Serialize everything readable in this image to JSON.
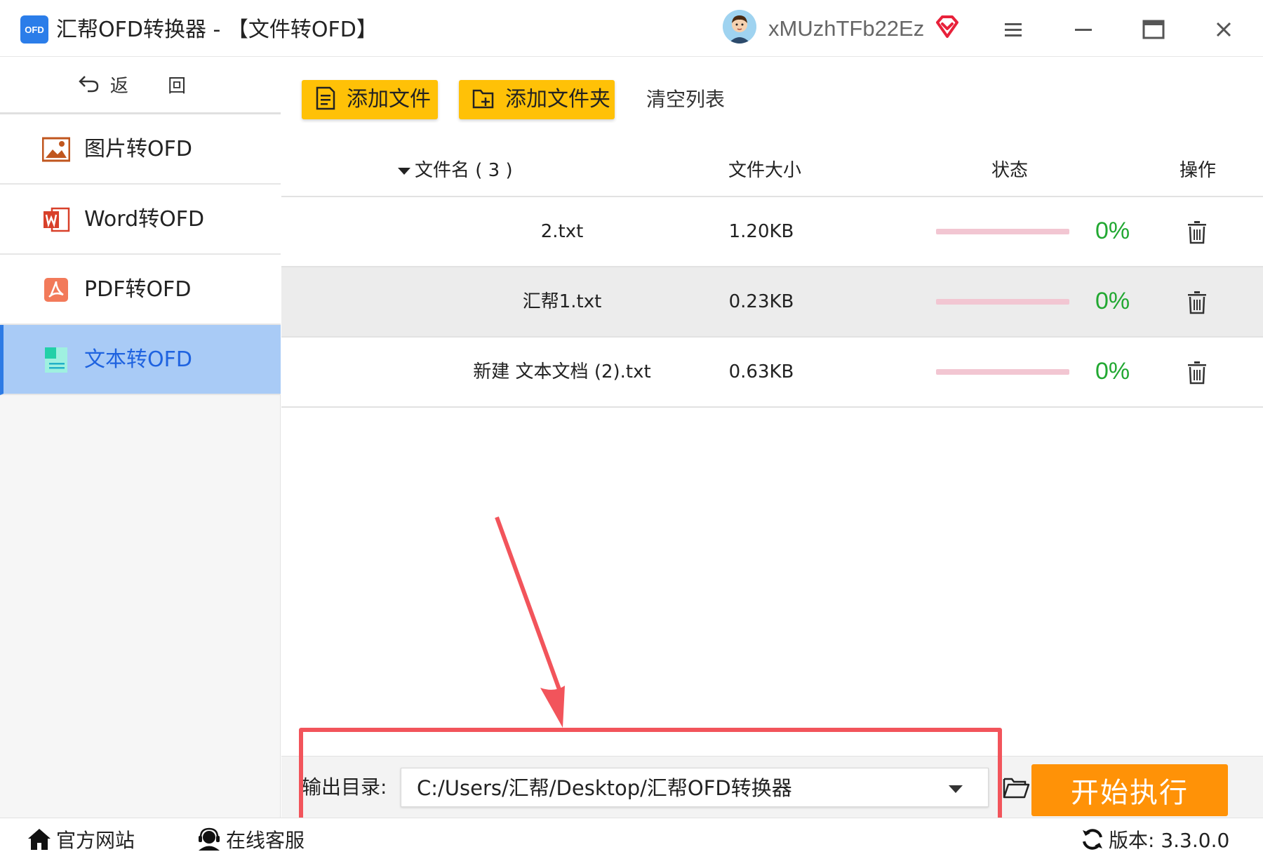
{
  "titlebar": {
    "logo_text": "OFD",
    "title": "汇帮OFD转换器 - 【文件转OFD】",
    "username": "xMUzhTFb22Ez"
  },
  "sidebar": {
    "back_label": "返 回",
    "items": [
      {
        "label": "图片转OFD"
      },
      {
        "label": "Word转OFD"
      },
      {
        "label": "PDF转OFD"
      },
      {
        "label": "文本转OFD"
      }
    ]
  },
  "toolbar": {
    "add_file": "添加文件",
    "add_folder": "添加文件夹",
    "clear_list": "清空列表"
  },
  "table": {
    "headers": {
      "name": "文件名 ( 3 )",
      "size": "文件大小",
      "status": "状态",
      "action": "操作"
    },
    "rows": [
      {
        "name": "2.txt",
        "size": "1.20KB",
        "progress": 0,
        "percent": "0%"
      },
      {
        "name": "汇帮1.txt",
        "size": "0.23KB",
        "progress": 0,
        "percent": "0%"
      },
      {
        "name": "新建 文本文档 (2).txt",
        "size": "0.63KB",
        "progress": 0,
        "percent": "0%"
      }
    ]
  },
  "output": {
    "label": "输出目录:",
    "path": "C:/Users/汇帮/Desktop/汇帮OFD转换器",
    "start_label": "开始执行"
  },
  "footer": {
    "website": "官方网站",
    "support": "在线客服",
    "version": "版本:  3.3.0.0"
  },
  "colors": {
    "accent_yellow": "#ffc107",
    "start_orange": "#ff9207",
    "active_nav": "#a9cbf6",
    "progress_green": "#22a832",
    "annotation_red": "#f2545b"
  }
}
